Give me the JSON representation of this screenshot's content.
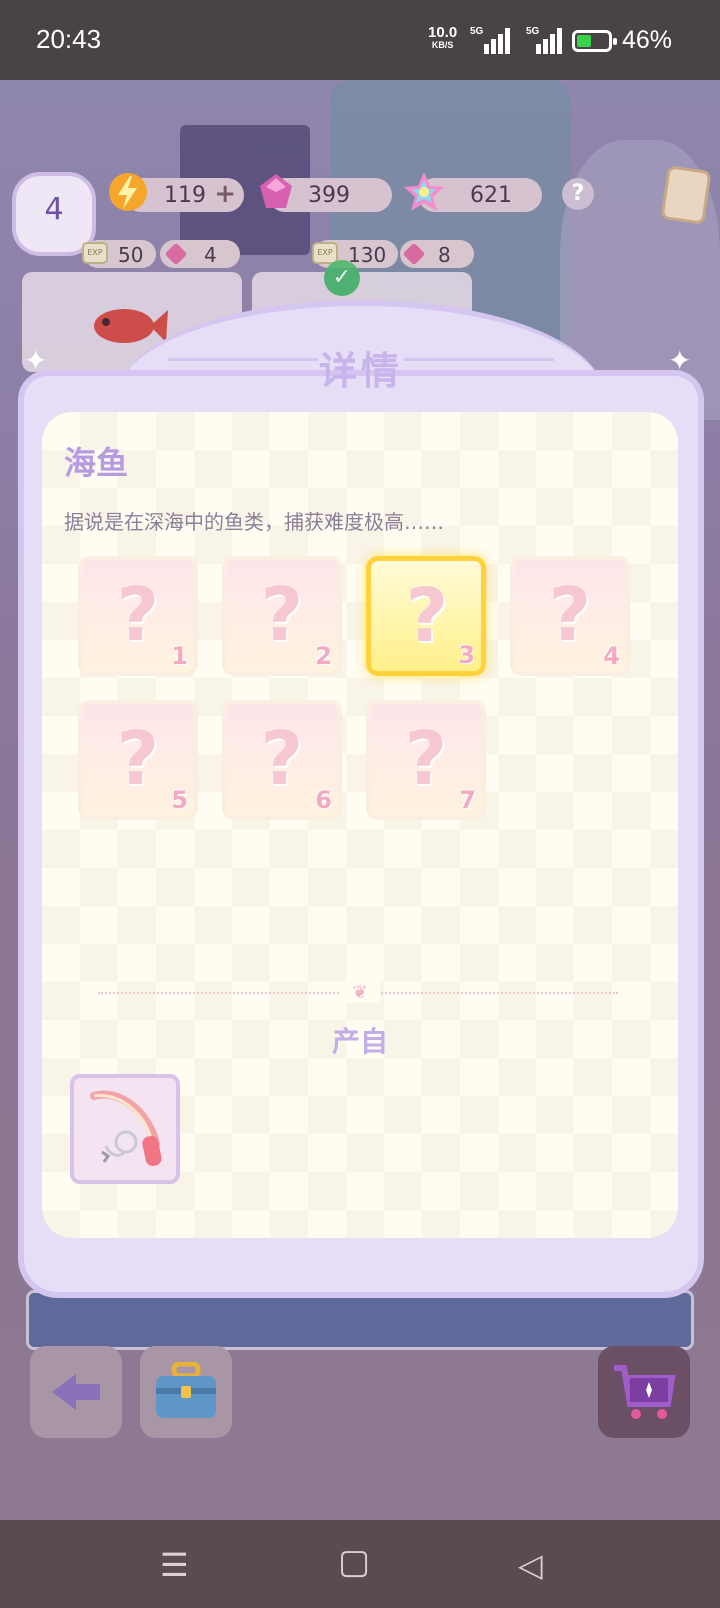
{
  "status_bar": {
    "time": "20:43",
    "net_speed": "10.0",
    "net_unit": "KB/S",
    "sim1": "5G",
    "sim2": "5G",
    "battery_percent": "46%",
    "battery_level": 0.46
  },
  "hud": {
    "level": "4",
    "energy": "119",
    "energy_plus": "+",
    "gems": "399",
    "stars": "621",
    "help": "?",
    "slot1": {
      "exp": "50",
      "gems": "4"
    },
    "slot2": {
      "exp": "130",
      "gems": "8"
    }
  },
  "modal": {
    "title": "详情",
    "item_name": "海鱼",
    "item_description": "据说是在深海中的鱼类，捕获难度极高……",
    "variants": [
      {
        "label": "?",
        "number": "1",
        "selected": false
      },
      {
        "label": "?",
        "number": "2",
        "selected": false
      },
      {
        "label": "?",
        "number": "3",
        "selected": true
      },
      {
        "label": "?",
        "number": "4",
        "selected": false
      },
      {
        "label": "?",
        "number": "5",
        "selected": false
      },
      {
        "label": "?",
        "number": "6",
        "selected": false
      },
      {
        "label": "?",
        "number": "7",
        "selected": false
      }
    ],
    "source_label": "产自",
    "source_items": [
      {
        "icon": "fishing-rod-icon"
      }
    ]
  },
  "bottom": {
    "back_icon": "back-arrow-icon",
    "toolbox_icon": "toolbox-icon",
    "shop_icon": "shopping-cart-icon"
  },
  "navbar": {
    "menu_icon": "menu-icon",
    "home_icon": "home-icon",
    "back_icon": "back-icon"
  }
}
